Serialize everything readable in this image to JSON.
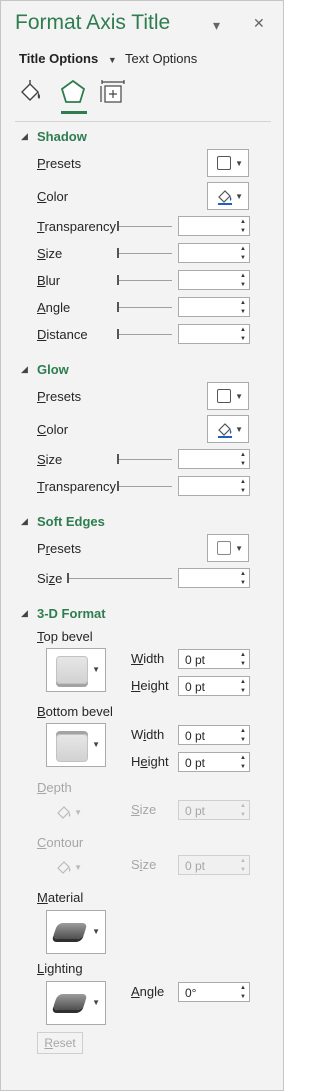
{
  "pane": {
    "title": "Format Axis Title",
    "pin_glyph": "▾",
    "close_glyph": "✕"
  },
  "tabs": {
    "title_options": "Title Options",
    "title_options_caret": "▼",
    "text_options": "Text Options"
  },
  "category_icons": [
    "fill-line-icon",
    "effects-icon",
    "size-properties-icon"
  ],
  "sections": {
    "shadow": {
      "title": "Shadow",
      "presets": {
        "pre": "",
        "u": "P",
        "post": "resets"
      },
      "color": {
        "pre": "",
        "u": "C",
        "post": "olor"
      },
      "transparency": {
        "pre": "",
        "u": "T",
        "post": "ransparency",
        "value": ""
      },
      "size": {
        "pre": "",
        "u": "S",
        "post": "ize",
        "value": ""
      },
      "blur": {
        "pre": "",
        "u": "B",
        "post": "lur",
        "value": ""
      },
      "angle": {
        "pre": "",
        "u": "A",
        "post": "ngle",
        "value": ""
      },
      "distance": {
        "pre": "",
        "u": "D",
        "post": "istance",
        "value": ""
      }
    },
    "glow": {
      "title": "Glow",
      "presets": {
        "pre": "",
        "u": "P",
        "post": "resets"
      },
      "color": {
        "pre": "",
        "u": "C",
        "post": "olor"
      },
      "size": {
        "pre": "",
        "u": "S",
        "post": "ize",
        "value": ""
      },
      "transparency": {
        "pre": "",
        "u": "T",
        "post": "ransparency",
        "value": ""
      }
    },
    "soft_edges": {
      "title": "Soft Edges",
      "presets": {
        "pre": "P",
        "u": "r",
        "post": "esets"
      },
      "size": {
        "pre": "Si",
        "u": "z",
        "post": "e",
        "value": ""
      }
    },
    "format3d": {
      "title": "3-D Format",
      "top_bevel": {
        "pre": "",
        "u": "T",
        "post": "op bevel"
      },
      "top_width": {
        "pre": "",
        "u": "W",
        "post": "idth",
        "value": "0 pt"
      },
      "top_height": {
        "pre": "",
        "u": "H",
        "post": "eight",
        "value": "0 pt"
      },
      "bottom_bevel": {
        "pre": "",
        "u": "B",
        "post": "ottom bevel"
      },
      "bottom_width": {
        "pre": "W",
        "u": "i",
        "post": "dth",
        "value": "0 pt"
      },
      "bottom_height": {
        "pre": "H",
        "u": "e",
        "post": "ight",
        "value": "0 pt"
      },
      "depth": {
        "pre": "",
        "u": "D",
        "post": "epth"
      },
      "depth_size": {
        "pre": "",
        "u": "S",
        "post": "ize",
        "value": "0 pt"
      },
      "contour": {
        "pre": "",
        "u": "C",
        "post": "ontour"
      },
      "contour_size": {
        "pre": "S",
        "u": "i",
        "post": "ze",
        "value": "0 pt"
      },
      "material": {
        "pre": "",
        "u": "M",
        "post": "aterial"
      },
      "lighting": {
        "pre": "",
        "u": "L",
        "post": "ighting"
      },
      "angle": {
        "pre": "",
        "u": "A",
        "post": "ngle",
        "value": "0°"
      },
      "reset": {
        "pre": "",
        "u": "R",
        "post": "eset"
      }
    }
  },
  "spin_up": "▲",
  "spin_down": "▼",
  "dd_caret": "▼",
  "section_expanded_glyph": "◢",
  "colors": {
    "accent": "#2e7d4f",
    "pane_bg": "#f3f3f3",
    "pen_blue": "#1f5fbf"
  }
}
